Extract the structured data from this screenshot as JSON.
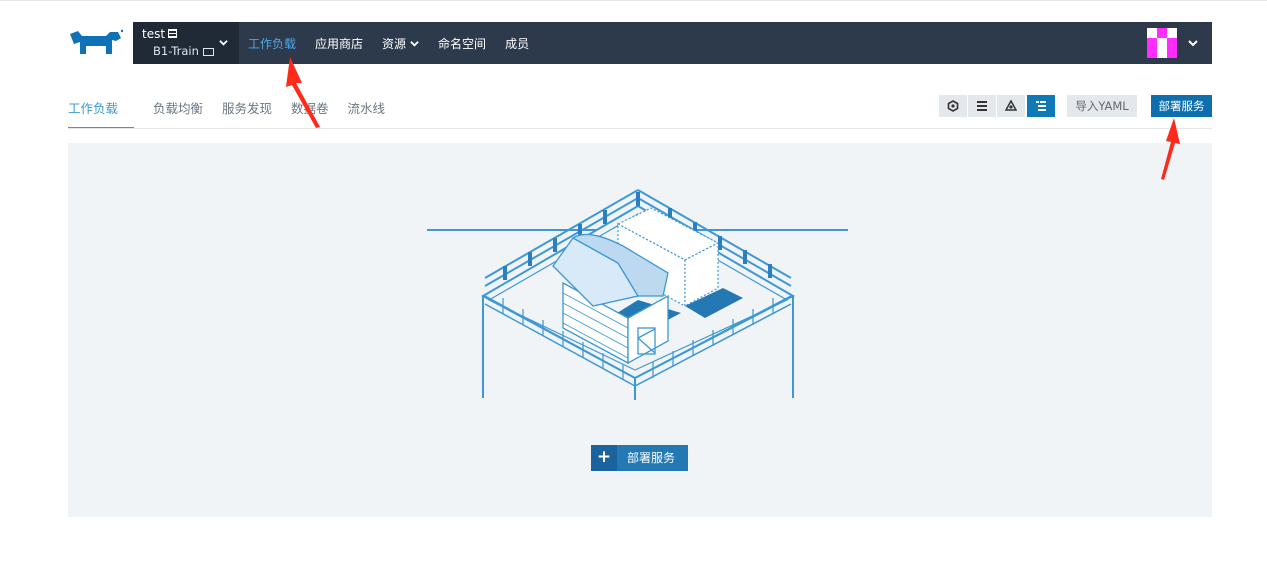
{
  "header": {
    "project_name": "test",
    "cluster_name": "B1-Train",
    "nav_items": [
      {
        "label": "工作负载",
        "active": true
      },
      {
        "label": "应用商店",
        "active": false
      },
      {
        "label": "资源",
        "active": false,
        "dropdown": true
      },
      {
        "label": "命名空间",
        "active": false
      },
      {
        "label": "成员",
        "active": false
      }
    ]
  },
  "subtabs": [
    {
      "label": "工作负载",
      "active": true
    },
    {
      "label": "负载均衡",
      "active": false
    },
    {
      "label": "服务发现",
      "active": false
    },
    {
      "label": "数据卷",
      "active": false
    },
    {
      "label": "流水线",
      "active": false
    }
  ],
  "toolbar": {
    "view_icons": [
      "node-view-icon",
      "list-view-icon",
      "group-view-icon",
      "tree-list-icon"
    ],
    "import_yaml_label": "导入YAML",
    "deploy_label": "部署服务"
  },
  "empty_state": {
    "deploy_label": "部署服务",
    "plus_symbol": "+"
  },
  "colors": {
    "navbar": "#2d3a4b",
    "accent": "#3d98d3",
    "primary_button": "#0f6fae",
    "annotation_arrow": "#ff2a1a"
  }
}
